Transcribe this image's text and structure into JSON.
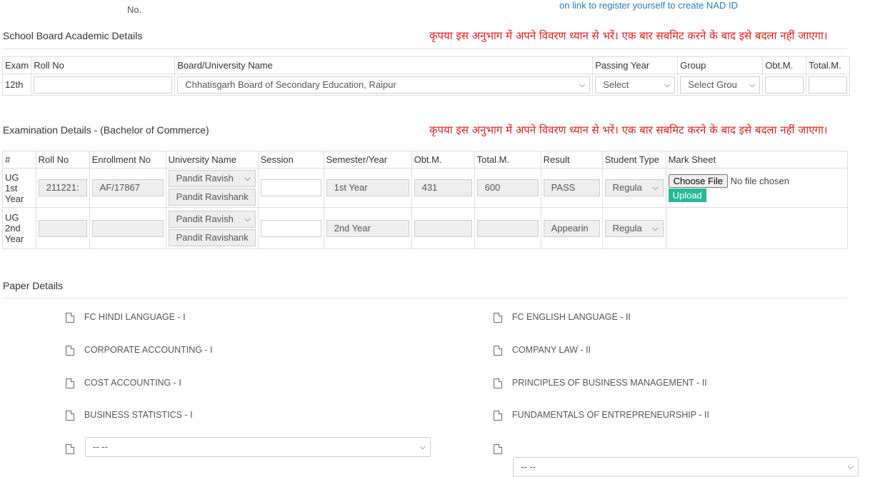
{
  "top": {
    "no_label": "No.",
    "nad_link": "on link to register yourself to create NAD ID"
  },
  "school": {
    "title": "School Board Academic Details",
    "warning": "कृपया इस अनुभाग में अपने विवरण ध्यान से भरें। एक बार सबमिट करने के बाद इसे बदला नहीं जाएगा।",
    "headers": {
      "exam": "Exam",
      "roll": "Roll No",
      "board": "Board/University Name",
      "year": "Passing Year",
      "group": "Group",
      "obt": "Obt.M.",
      "total": "Total.M."
    },
    "row": {
      "exam": "12th",
      "roll": "",
      "board": "Chhatisgarh Board of Secondary Education, Raipur",
      "year": "Select",
      "group": "Select Grou",
      "obt": "",
      "total": ""
    }
  },
  "exam": {
    "title": "Examination Details - (Bachelor of Commerce)",
    "warning": "कृपया इस अनुभाग में अपने विवरण ध्यान से भरें। एक बार सबमिट करने के बाद इसे बदला नहीं जाएगा।",
    "headers": {
      "num": "#",
      "roll": "Roll No",
      "enroll": "Enrollment No",
      "univ": "University Name",
      "session": "Session",
      "sem": "Semester/Year",
      "obt": "Obt.M.",
      "total": "Total.M.",
      "result": "Result",
      "stype": "Student Type",
      "marksheet": "Mark Sheet"
    },
    "rows": [
      {
        "label": "UG 1st Year",
        "roll": "211221:",
        "enroll": "AF/17867",
        "univ_sel": "Pandit Ravish",
        "univ_text": "Pandit Ravishank",
        "session": "",
        "sem": "1st Year",
        "obt": "431",
        "total": "600",
        "result": "PASS",
        "stype": "Regula",
        "choose": "Choose File",
        "nofile": "No file chosen",
        "upload": "Upload"
      },
      {
        "label": "UG 2nd Year",
        "roll": "",
        "enroll": "",
        "univ_sel": "Pandit Ravish",
        "univ_text": "Pandit Ravishank",
        "session": "",
        "sem": "2nd Year",
        "obt": "",
        "total": "",
        "result": "Appearin",
        "stype": "Regula"
      }
    ]
  },
  "papers": {
    "title": "Paper Details",
    "left": [
      "FC HINDI LANGUAGE - I",
      "CORPORATE ACCOUNTING - I",
      "COST ACCOUNTING - I",
      "BUSINESS STATISTICS - I"
    ],
    "right": [
      "FC ENGLISH LANGUAGE - II",
      "COMPANY LAW - II",
      "PRINCIPLES OF BUSINESS MANAGEMENT - II",
      "FUNDAMENTALS OF ENTREPRENEURSHIP - II"
    ],
    "left_select": "-- --",
    "right_select": "-- --"
  }
}
